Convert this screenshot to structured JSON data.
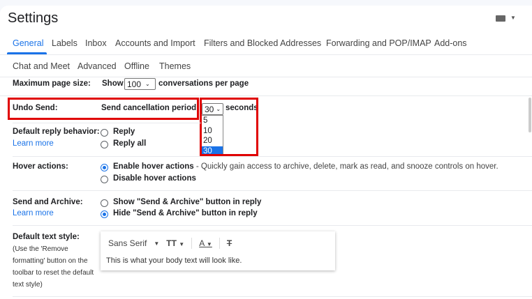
{
  "header": {
    "title": "Settings",
    "keyboard_icon": "keyboard-icon"
  },
  "tabs": [
    "General",
    "Labels",
    "Inbox",
    "Accounts and Import",
    "Filters and Blocked Addresses",
    "Forwarding and POP/IMAP",
    "Add-ons",
    "Chat and Meet",
    "Advanced",
    "Offline",
    "Themes"
  ],
  "active_tab": "General",
  "max_page": {
    "label": "Maximum page size:",
    "prefix": "Show",
    "value": "100",
    "suffix": "conversations per page"
  },
  "undo_send": {
    "label": "Undo Send:",
    "text": "Send cancellation period",
    "value": "30",
    "suffix": "seconds",
    "options": [
      "5",
      "10",
      "20",
      "30"
    ],
    "highlighted": "30"
  },
  "reply": {
    "label": "Default reply behavior:",
    "learn_more": "Learn more",
    "options": [
      "Reply",
      "Reply all"
    ]
  },
  "hover": {
    "label": "Hover actions:",
    "enable": "Enable hover actions",
    "enable_desc": "- Quickly gain access to archive, delete, mark as read, and snooze controls on hover.",
    "disable": "Disable hover actions"
  },
  "send_archive": {
    "label": "Send and Archive:",
    "learn_more": "Learn more",
    "show": "Show \"Send & Archive\" button in reply",
    "hide": "Hide \"Send & Archive\" button in reply"
  },
  "text_style": {
    "label": "Default text style:",
    "note": "(Use the 'Remove formatting' button on the toolbar to reset the default text style)",
    "font": "Sans Serif",
    "size_icon": "TT",
    "color_icon": "A",
    "preview": "This is what your body text will look like."
  },
  "colors": {
    "accent": "#1a73e8",
    "annotation": "#e00000"
  }
}
